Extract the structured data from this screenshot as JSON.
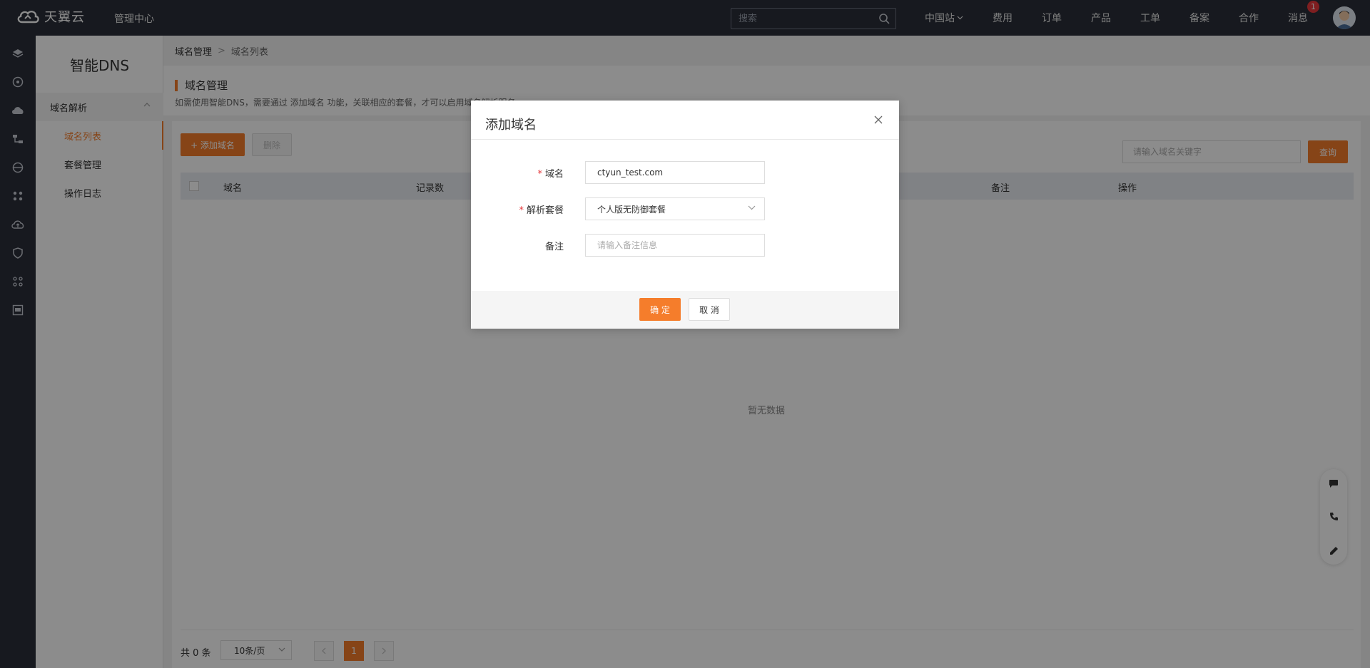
{
  "brand": {
    "name": "天翼云",
    "section": "管理中心"
  },
  "search": {
    "placeholder": "搜索"
  },
  "nav": {
    "region": "中国站",
    "items": [
      "费用",
      "订单",
      "产品",
      "工单",
      "备案",
      "合作"
    ],
    "messages": {
      "label": "消息",
      "badge": "1"
    }
  },
  "rail_icons": [
    "layers-icon",
    "dashboard-icon",
    "cloud-icon",
    "network-icon",
    "database-icon",
    "cluster-icon",
    "cloud-upload-icon",
    "shield-icon",
    "grid-icon",
    "monitor-icon"
  ],
  "sidebar": {
    "title": "智能DNS",
    "group": "域名解析",
    "items": [
      {
        "label": "域名列表",
        "active": true
      },
      {
        "label": "套餐管理",
        "active": false
      },
      {
        "label": "操作日志",
        "active": false
      }
    ]
  },
  "breadcrumb": {
    "root": "域名管理",
    "current": "域名列表"
  },
  "page": {
    "title": "域名管理",
    "description": "如需使用智能DNS，需要通过 添加域名 功能，关联相应的套餐，才可以启用域名解析服务。"
  },
  "toolbar": {
    "add_label": "+ 添加域名",
    "delete_label": "删除",
    "keyword_placeholder": "请输入域名关键字",
    "query_label": "查询"
  },
  "table": {
    "columns": [
      "域名",
      "记录数",
      "备注",
      "操作"
    ],
    "empty_text": "暂无数据"
  },
  "pagination": {
    "total": "共 0 条",
    "page_size": "10条/页",
    "current_page": "1"
  },
  "modal": {
    "title": "添加域名",
    "fields": {
      "domain": {
        "label": "域名",
        "value": "ctyun_test.com"
      },
      "package": {
        "label": "解析套餐",
        "value": "个人版无防御套餐"
      },
      "remark": {
        "label": "备注",
        "placeholder": "请输入备注信息"
      }
    },
    "ok_label": "确 定",
    "cancel_label": "取 消"
  },
  "colors": {
    "accent": "#f57d2b",
    "topbar": "#2b2f3a"
  }
}
